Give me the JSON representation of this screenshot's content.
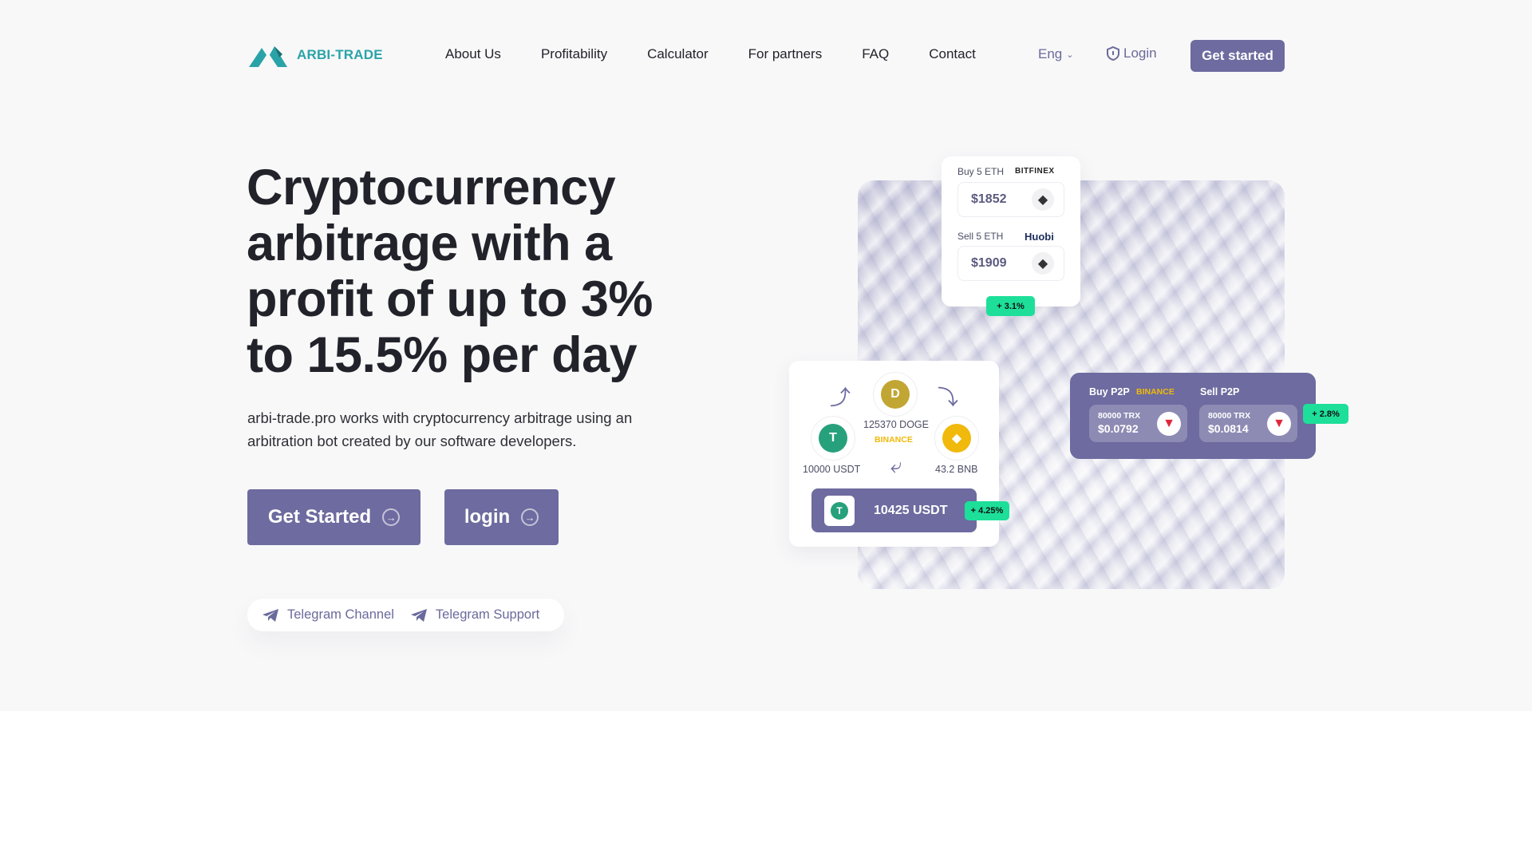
{
  "header": {
    "logo_text": "ARBI-TRADE",
    "nav": [
      "About Us",
      "Profitability",
      "Calculator",
      "For partners",
      "FAQ",
      "Contact"
    ],
    "lang": "Eng",
    "login": "Login",
    "cta": "Get started"
  },
  "hero": {
    "headline": "Cryptocurrency arbitrage with a profit of up to 3% to 15.5% per day",
    "description": "arbi-trade.pro works with cryptocurrency arbitrage using an arbitration bot created by our software developers.",
    "get_started": "Get Started",
    "login": "login",
    "telegram_channel": "Telegram Channel",
    "telegram_support": "Telegram Support"
  },
  "exchange_card": {
    "buy_label": "Buy 5 ETH",
    "buy_exchange": "BITFINEX",
    "buy_price": "$1852",
    "sell_label": "Sell 5 ETH",
    "sell_exchange": "Huobi",
    "sell_price": "$1909",
    "profit": "+ 3.1%"
  },
  "doge_card": {
    "doge_amount": "125370 DOGE",
    "exchange": "BINANCE",
    "usdt_start": "10000 USDT",
    "bnb_amount": "43.2 BNB",
    "usdt_result": "10425 USDT",
    "profit": "+ 4.25%"
  },
  "p2p_card": {
    "buy_label": "Buy P2P",
    "exchange": "BINANCE",
    "sell_label": "Sell P2P",
    "buy_amount": "80000 TRX",
    "buy_price": "$0.0792",
    "sell_amount": "80000 TRX",
    "sell_price": "$0.0814",
    "profit": "+ 2.8%"
  },
  "colors": {
    "accent": "#6d6b9f",
    "brand": "#2aa3a8",
    "profit": "#1ddf9a",
    "binance": "#f0b90b"
  }
}
